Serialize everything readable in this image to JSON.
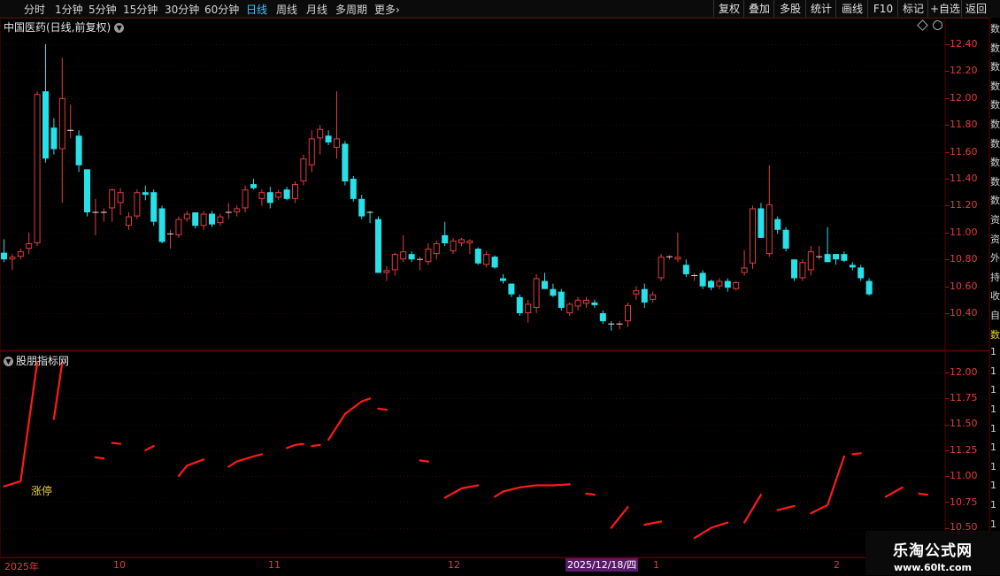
{
  "toolbar": {
    "periods": [
      "分时",
      "1分钟",
      "5分钟",
      "15分钟",
      "30分钟",
      "60分钟",
      "日线",
      "周线",
      "月线",
      "多周期"
    ],
    "active_index": 6,
    "more_label": "更多",
    "buttons": [
      "复权",
      "叠加",
      "多股",
      "统计",
      "画线",
      "F10",
      "标记",
      "+自选",
      "返回"
    ]
  },
  "stock": {
    "title": "中国医药(日线,前复权)"
  },
  "indicator": {
    "title": "股朋指标网",
    "limit_up_label": "涨停"
  },
  "price_axis": {
    "labels": [
      "12.40",
      "12.20",
      "12.00",
      "11.80",
      "11.60",
      "11.40",
      "11.20",
      "11.00",
      "10.80",
      "10.60",
      "10.40"
    ]
  },
  "ind_axis": {
    "labels": [
      "12.00",
      "11.75",
      "11.50",
      "11.25",
      "11.00",
      "10.75",
      "10.50"
    ]
  },
  "date_axis": {
    "labels": [
      "2025年",
      "10",
      "11",
      "12",
      "1",
      "2"
    ],
    "selected_label": "2025/12/18/四"
  },
  "right_strip": {
    "chars": [
      "数",
      "数",
      "数",
      "数",
      "数",
      "数",
      "数",
      "数",
      "数",
      "数",
      "资",
      "资",
      "外",
      "持",
      "收",
      "自",
      "数",
      "1",
      "1",
      "1",
      "1",
      "1",
      "1",
      "1",
      "1",
      "1",
      "1",
      "1"
    ]
  },
  "watermark": {
    "line1": "乐淘公式网",
    "line2": "www.60lt.com"
  },
  "colors": {
    "up": "#e23c3c",
    "down": "#28e0e8",
    "line": "#ff1a1a",
    "active": "#3cc6ff",
    "limit_up": "#e8d23c"
  },
  "chart_data": {
    "type": "candlestick",
    "y_range": [
      10.25,
      12.5
    ],
    "candles": [
      {
        "o": 10.85,
        "h": 10.95,
        "l": 10.78,
        "c": 10.8
      },
      {
        "o": 10.8,
        "h": 10.84,
        "l": 10.72,
        "c": 10.82
      },
      {
        "o": 10.82,
        "h": 10.88,
        "l": 10.8,
        "c": 10.86
      },
      {
        "o": 10.88,
        "h": 11.0,
        "l": 10.84,
        "c": 10.92
      },
      {
        "o": 10.92,
        "h": 12.05,
        "l": 10.9,
        "c": 12.03
      },
      {
        "o": 12.05,
        "h": 12.4,
        "l": 11.52,
        "c": 11.55
      },
      {
        "o": 11.78,
        "h": 11.85,
        "l": 11.58,
        "c": 11.62
      },
      {
        "o": 11.62,
        "h": 12.3,
        "l": 11.22,
        "c": 12.0
      },
      {
        "o": 11.75,
        "h": 11.95,
        "l": 11.7,
        "c": 11.76
      },
      {
        "o": 11.72,
        "h": 11.76,
        "l": 11.45,
        "c": 11.5
      },
      {
        "o": 11.47,
        "h": 11.47,
        "l": 11.12,
        "c": 11.15
      },
      {
        "o": 11.15,
        "h": 11.25,
        "l": 10.98,
        "c": 11.15
      },
      {
        "o": 11.14,
        "h": 11.18,
        "l": 11.08,
        "c": 11.15
      },
      {
        "o": 11.18,
        "h": 11.33,
        "l": 11.08,
        "c": 11.32
      },
      {
        "o": 11.22,
        "h": 11.33,
        "l": 11.13,
        "c": 11.3
      },
      {
        "o": 11.05,
        "h": 11.15,
        "l": 11.02,
        "c": 11.12
      },
      {
        "o": 11.12,
        "h": 11.32,
        "l": 11.1,
        "c": 11.3
      },
      {
        "o": 11.3,
        "h": 11.35,
        "l": 11.24,
        "c": 11.28
      },
      {
        "o": 11.3,
        "h": 11.32,
        "l": 11.05,
        "c": 11.08
      },
      {
        "o": 11.18,
        "h": 11.2,
        "l": 10.92,
        "c": 10.93
      },
      {
        "o": 10.98,
        "h": 11.02,
        "l": 10.88,
        "c": 10.99
      },
      {
        "o": 10.98,
        "h": 11.12,
        "l": 10.96,
        "c": 11.1
      },
      {
        "o": 11.1,
        "h": 11.16,
        "l": 11.08,
        "c": 11.14
      },
      {
        "o": 11.15,
        "h": 11.15,
        "l": 11.03,
        "c": 11.05
      },
      {
        "o": 11.05,
        "h": 11.16,
        "l": 11.02,
        "c": 11.14
      },
      {
        "o": 11.14,
        "h": 11.16,
        "l": 11.04,
        "c": 11.06
      },
      {
        "o": 11.07,
        "h": 11.14,
        "l": 11.05,
        "c": 11.12
      },
      {
        "o": 11.14,
        "h": 11.22,
        "l": 11.1,
        "c": 11.15
      },
      {
        "o": 11.15,
        "h": 11.2,
        "l": 11.12,
        "c": 11.18
      },
      {
        "o": 11.18,
        "h": 11.35,
        "l": 11.15,
        "c": 11.32
      },
      {
        "o": 11.36,
        "h": 11.4,
        "l": 11.32,
        "c": 11.33
      },
      {
        "o": 11.25,
        "h": 11.32,
        "l": 11.2,
        "c": 11.3
      },
      {
        "o": 11.3,
        "h": 11.34,
        "l": 11.18,
        "c": 11.22
      },
      {
        "o": 11.26,
        "h": 11.32,
        "l": 11.24,
        "c": 11.3
      },
      {
        "o": 11.32,
        "h": 11.34,
        "l": 11.24,
        "c": 11.25
      },
      {
        "o": 11.25,
        "h": 11.38,
        "l": 11.22,
        "c": 11.36
      },
      {
        "o": 11.38,
        "h": 11.58,
        "l": 11.35,
        "c": 11.55
      },
      {
        "o": 11.5,
        "h": 11.76,
        "l": 11.45,
        "c": 11.7
      },
      {
        "o": 11.7,
        "h": 11.8,
        "l": 11.58,
        "c": 11.77
      },
      {
        "o": 11.72,
        "h": 11.76,
        "l": 11.65,
        "c": 11.67
      },
      {
        "o": 11.63,
        "h": 12.05,
        "l": 11.55,
        "c": 11.7
      },
      {
        "o": 11.66,
        "h": 11.68,
        "l": 11.35,
        "c": 11.38
      },
      {
        "o": 11.4,
        "h": 11.42,
        "l": 11.23,
        "c": 11.25
      },
      {
        "o": 11.25,
        "h": 11.28,
        "l": 11.1,
        "c": 11.12
      },
      {
        "o": 11.15,
        "h": 11.16,
        "l": 11.07,
        "c": 11.14
      },
      {
        "o": 11.1,
        "h": 11.12,
        "l": 10.7,
        "c": 10.7
      },
      {
        "o": 10.7,
        "h": 10.75,
        "l": 10.64,
        "c": 10.72
      },
      {
        "o": 10.72,
        "h": 10.85,
        "l": 10.68,
        "c": 10.84
      },
      {
        "o": 10.8,
        "h": 10.98,
        "l": 10.78,
        "c": 10.86
      },
      {
        "o": 10.84,
        "h": 10.86,
        "l": 10.78,
        "c": 10.8
      },
      {
        "o": 10.8,
        "h": 10.82,
        "l": 10.72,
        "c": 10.8
      },
      {
        "o": 10.78,
        "h": 10.92,
        "l": 10.76,
        "c": 10.88
      },
      {
        "o": 10.84,
        "h": 10.94,
        "l": 10.8,
        "c": 10.92
      },
      {
        "o": 10.98,
        "h": 11.08,
        "l": 10.9,
        "c": 10.92
      },
      {
        "o": 10.86,
        "h": 10.96,
        "l": 10.84,
        "c": 10.94
      },
      {
        "o": 10.92,
        "h": 10.96,
        "l": 10.9,
        "c": 10.95
      },
      {
        "o": 10.92,
        "h": 10.95,
        "l": 10.84,
        "c": 10.94
      },
      {
        "o": 10.88,
        "h": 10.89,
        "l": 10.76,
        "c": 10.77
      },
      {
        "o": 10.76,
        "h": 10.86,
        "l": 10.74,
        "c": 10.84
      },
      {
        "o": 10.82,
        "h": 10.83,
        "l": 10.73,
        "c": 10.74
      },
      {
        "o": 10.66,
        "h": 10.69,
        "l": 10.62,
        "c": 10.64
      },
      {
        "o": 10.62,
        "h": 10.62,
        "l": 10.52,
        "c": 10.54
      },
      {
        "o": 10.52,
        "h": 10.54,
        "l": 10.38,
        "c": 10.4
      },
      {
        "o": 10.4,
        "h": 10.5,
        "l": 10.33,
        "c": 10.47
      },
      {
        "o": 10.44,
        "h": 10.69,
        "l": 10.4,
        "c": 10.66
      },
      {
        "o": 10.64,
        "h": 10.7,
        "l": 10.58,
        "c": 10.58
      },
      {
        "o": 10.58,
        "h": 10.62,
        "l": 10.52,
        "c": 10.53
      },
      {
        "o": 10.56,
        "h": 10.58,
        "l": 10.42,
        "c": 10.44
      },
      {
        "o": 10.4,
        "h": 10.48,
        "l": 10.38,
        "c": 10.47
      },
      {
        "o": 10.45,
        "h": 10.52,
        "l": 10.42,
        "c": 10.5
      },
      {
        "o": 10.47,
        "h": 10.52,
        "l": 10.44,
        "c": 10.5
      },
      {
        "o": 10.48,
        "h": 10.5,
        "l": 10.44,
        "c": 10.46
      },
      {
        "o": 10.4,
        "h": 10.42,
        "l": 10.32,
        "c": 10.34
      },
      {
        "o": 10.32,
        "h": 10.34,
        "l": 10.27,
        "c": 10.31
      },
      {
        "o": 10.31,
        "h": 10.34,
        "l": 10.28,
        "c": 10.32
      },
      {
        "o": 10.34,
        "h": 10.48,
        "l": 10.3,
        "c": 10.46
      },
      {
        "o": 10.54,
        "h": 10.6,
        "l": 10.5,
        "c": 10.57
      },
      {
        "o": 10.58,
        "h": 10.62,
        "l": 10.44,
        "c": 10.48
      },
      {
        "o": 10.5,
        "h": 10.56,
        "l": 10.48,
        "c": 10.54
      },
      {
        "o": 10.66,
        "h": 10.84,
        "l": 10.64,
        "c": 10.82
      },
      {
        "o": 10.81,
        "h": 10.83,
        "l": 10.8,
        "c": 10.82
      },
      {
        "o": 10.8,
        "h": 11.0,
        "l": 10.78,
        "c": 10.82
      },
      {
        "o": 10.76,
        "h": 10.8,
        "l": 10.67,
        "c": 10.69
      },
      {
        "o": 10.67,
        "h": 10.7,
        "l": 10.64,
        "c": 10.68
      },
      {
        "o": 10.7,
        "h": 10.72,
        "l": 10.58,
        "c": 10.6
      },
      {
        "o": 10.64,
        "h": 10.65,
        "l": 10.57,
        "c": 10.59
      },
      {
        "o": 10.6,
        "h": 10.66,
        "l": 10.58,
        "c": 10.64
      },
      {
        "o": 10.64,
        "h": 10.66,
        "l": 10.56,
        "c": 10.59
      },
      {
        "o": 10.58,
        "h": 10.64,
        "l": 10.57,
        "c": 10.63
      },
      {
        "o": 10.7,
        "h": 10.87,
        "l": 10.68,
        "c": 10.74
      },
      {
        "o": 10.77,
        "h": 11.2,
        "l": 10.73,
        "c": 11.18
      },
      {
        "o": 11.18,
        "h": 11.22,
        "l": 10.96,
        "c": 10.96
      },
      {
        "o": 10.84,
        "h": 11.5,
        "l": 10.82,
        "c": 11.21
      },
      {
        "o": 11.1,
        "h": 11.12,
        "l": 10.99,
        "c": 11.02
      },
      {
        "o": 11.02,
        "h": 11.04,
        "l": 10.86,
        "c": 10.88
      },
      {
        "o": 10.8,
        "h": 10.8,
        "l": 10.64,
        "c": 10.66
      },
      {
        "o": 10.66,
        "h": 10.8,
        "l": 10.64,
        "c": 10.78
      },
      {
        "o": 10.72,
        "h": 10.9,
        "l": 10.68,
        "c": 10.86
      },
      {
        "o": 10.82,
        "h": 10.9,
        "l": 10.8,
        "c": 10.82
      },
      {
        "o": 10.84,
        "h": 11.04,
        "l": 10.78,
        "c": 10.78
      },
      {
        "o": 10.84,
        "h": 10.84,
        "l": 10.76,
        "c": 10.8
      },
      {
        "o": 10.84,
        "h": 10.86,
        "l": 10.78,
        "c": 10.79
      },
      {
        "o": 10.76,
        "h": 10.78,
        "l": 10.72,
        "c": 10.74
      },
      {
        "o": 10.74,
        "h": 10.76,
        "l": 10.64,
        "c": 10.66
      },
      {
        "o": 10.64,
        "h": 10.66,
        "l": 10.53,
        "c": 10.54
      }
    ],
    "indicator": {
      "y_range": [
        10.47,
        12.1
      ],
      "segments": [
        [
          [
            0,
            10.9
          ],
          [
            2,
            10.95
          ],
          [
            4,
            12.1
          ]
        ],
        [
          [
            6,
            11.55
          ],
          [
            7,
            12.1
          ]
        ],
        [
          [
            11,
            11.18
          ],
          [
            12,
            11.17
          ]
        ],
        [
          [
            13,
            11.32
          ],
          [
            14,
            11.31
          ]
        ],
        [
          [
            17,
            11.25
          ],
          [
            18,
            11.29
          ]
        ],
        [
          [
            21,
            11.0
          ],
          [
            22,
            11.1
          ],
          [
            23,
            11.13
          ],
          [
            24,
            11.16
          ]
        ],
        [
          [
            27,
            11.09
          ],
          [
            28,
            11.14
          ],
          [
            30,
            11.19
          ],
          [
            31,
            11.21
          ]
        ],
        [
          [
            34,
            11.27
          ],
          [
            35,
            11.3
          ],
          [
            36,
            11.31
          ]
        ],
        [
          [
            37,
            11.29
          ],
          [
            38,
            11.3
          ]
        ],
        [
          [
            39,
            11.35
          ],
          [
            41,
            11.6
          ],
          [
            43,
            11.72
          ],
          [
            44,
            11.75
          ]
        ],
        [
          [
            45,
            11.65
          ],
          [
            46,
            11.64
          ]
        ],
        [
          [
            50,
            11.15
          ],
          [
            51,
            11.14
          ]
        ],
        [
          [
            53,
            10.79
          ],
          [
            55,
            10.88
          ],
          [
            57,
            10.91
          ]
        ],
        [
          [
            59,
            10.8
          ],
          [
            60,
            10.85
          ],
          [
            62,
            10.89
          ],
          [
            64,
            10.91
          ],
          [
            66,
            10.91
          ],
          [
            68,
            10.92
          ]
        ],
        [
          [
            70,
            10.83
          ],
          [
            71,
            10.82
          ]
        ],
        [
          [
            73,
            10.5
          ],
          [
            75,
            10.7
          ]
        ],
        [
          [
            77,
            10.53
          ],
          [
            79,
            10.56
          ]
        ],
        [
          [
            83,
            10.4
          ],
          [
            85,
            10.5
          ],
          [
            87,
            10.55
          ]
        ],
        [
          [
            89,
            10.55
          ],
          [
            91,
            10.82
          ]
        ],
        [
          [
            93,
            10.67
          ],
          [
            95,
            10.71
          ]
        ],
        [
          [
            97,
            10.64
          ],
          [
            99,
            10.72
          ],
          [
            101,
            11.19
          ]
        ],
        [
          [
            102,
            11.21
          ],
          [
            103,
            11.22
          ]
        ],
        [
          [
            106,
            10.8
          ],
          [
            108,
            10.89
          ]
        ],
        [
          [
            110,
            10.83
          ],
          [
            111,
            10.82
          ]
        ]
      ]
    }
  }
}
